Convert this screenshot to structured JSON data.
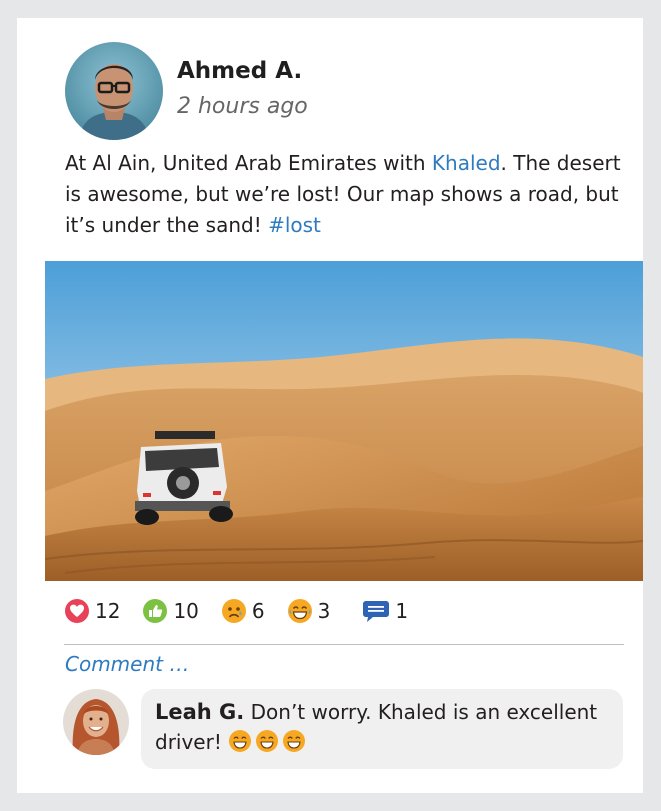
{
  "post": {
    "author": "Ahmed A.",
    "time": "2 hours ago",
    "text_before": "At Al Ain, United Arab Emirates with ",
    "mention": "Khaled",
    "text_mid": ". The desert is awesome, but we’re lost! Our map shows a road, but it’s under the sand! ",
    "hashtag": "#lost",
    "photo_description_icon": "desert-suv-photo"
  },
  "reactions": [
    {
      "name": "love",
      "count": "12",
      "icon": "heart-icon",
      "color": "#e8415a"
    },
    {
      "name": "like",
      "count": "10",
      "icon": "thumbs-up-icon",
      "color": "#7cc142"
    },
    {
      "name": "sad",
      "count": "6",
      "icon": "sad-face-icon",
      "color": "#f7a823"
    },
    {
      "name": "laugh",
      "count": "3",
      "icon": "laugh-face-icon",
      "color": "#f7a823"
    },
    {
      "name": "comments",
      "count": "1",
      "icon": "comment-icon",
      "color": "#2f63b5"
    }
  ],
  "comment_box": {
    "placeholder": "Comment …"
  },
  "comment": {
    "author": "Leah G.",
    "text": " Don’t worry. Khaled is an excellent driver! ",
    "emoji_icon": "laugh-face-icon"
  },
  "colors": {
    "link": "#2f7bbf",
    "background": "#e6e7e8",
    "bubble": "#f0f0f0"
  }
}
